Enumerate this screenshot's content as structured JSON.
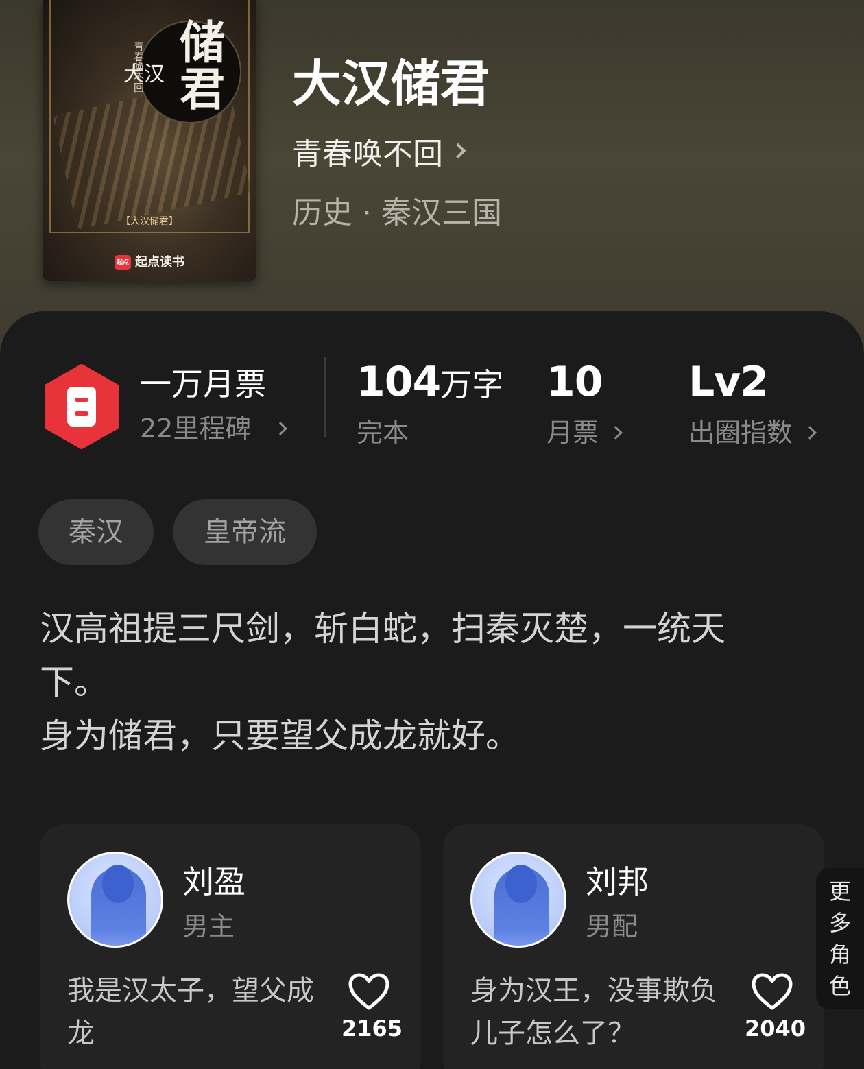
{
  "book": {
    "title": "大汉储君",
    "author": "青春唤不回",
    "category": "历史 · 秦汉三国"
  },
  "cover": {
    "title_main": "储君",
    "title_small": "大汉",
    "author_vertical": "青春唤不回",
    "subtitle": "【大汉储君】",
    "brand": "起点读书",
    "brand_logo": "起点"
  },
  "stats": {
    "ticket_title": "一万月票",
    "ticket_sub": "22里程碑",
    "word_count": "104",
    "word_unit": "万字",
    "status": "完本",
    "monthly_tickets": "10",
    "monthly_label": "月票",
    "influence_value": "Lv2",
    "influence_label": "出圈指数"
  },
  "tags": [
    "秦汉",
    "皇帝流"
  ],
  "synopsis": "汉高祖提三尺剑，斩白蛇，扫秦灭楚，一统天下。\n身为储君，只要望父成龙就好。",
  "characters": [
    {
      "name": "刘盈",
      "role": "男主",
      "quote": "我是汉太子，望父成龙",
      "likes": "2165"
    },
    {
      "name": "刘邦",
      "role": "男配",
      "quote": "身为汉王，没事欺负儿子怎么了？",
      "likes": "2040"
    }
  ],
  "more_roles": [
    "更",
    "多",
    "角",
    "色"
  ],
  "colors": {
    "badge": "#e8333a",
    "panel": "#1b1b1b",
    "card": "#232323",
    "tag_bg": "#333333"
  },
  "icons": {
    "milestone": "ticket-badge-icon",
    "like": "heart-outline-icon",
    "chevron": "chevron-right-icon"
  }
}
